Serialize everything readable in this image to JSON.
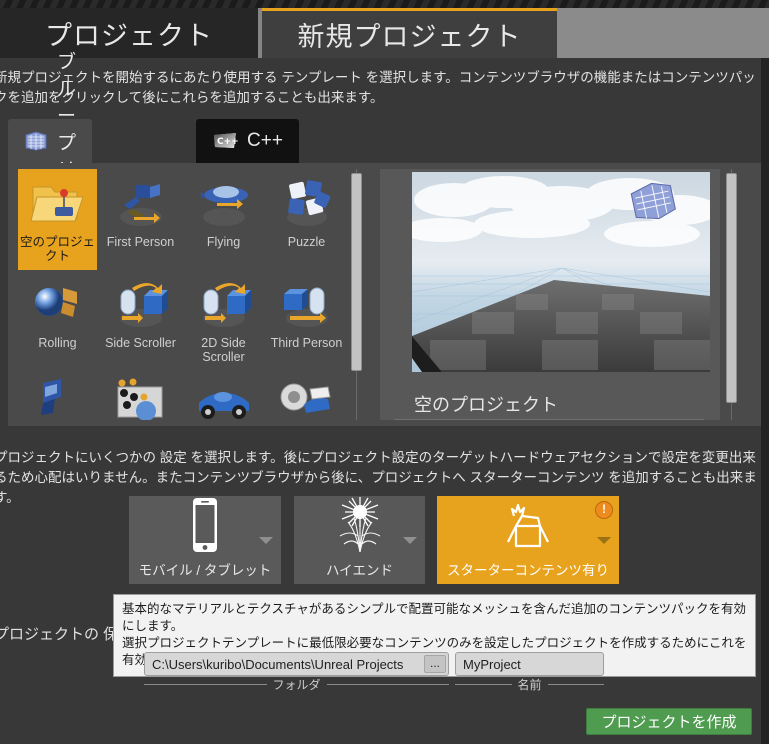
{
  "window": {
    "tabs": [
      {
        "label": "プロジェクト",
        "active": false
      },
      {
        "label": "新規プロジェクト",
        "active": true
      }
    ],
    "accent_color": "#e8a31e"
  },
  "template_section": {
    "description": "新規プロジェクトを開始するにあたり使用する テンプレート を選択します。コンテンツブラウザの機能またはコンテンツパックを追加をクリックして後にこれらを追加することも出来ます。",
    "category_tabs": [
      {
        "label": "ブループリント",
        "icon": "blueprint-icon",
        "active": true
      },
      {
        "label": "C++",
        "icon": "cpp-icon",
        "active": false
      }
    ],
    "templates": [
      {
        "label": "空のプロジェクト",
        "icon": "empty-project-icon",
        "selected": true
      },
      {
        "label": "First Person",
        "icon": "first-person-icon",
        "selected": false
      },
      {
        "label": "Flying",
        "icon": "flying-icon",
        "selected": false
      },
      {
        "label": "Puzzle",
        "icon": "puzzle-icon",
        "selected": false
      },
      {
        "label": "Rolling",
        "icon": "rolling-icon",
        "selected": false
      },
      {
        "label": "Side Scroller",
        "icon": "side-scroller-icon",
        "selected": false
      },
      {
        "label": "2D Side Scroller",
        "icon": "2d-side-scroller-icon",
        "selected": false
      },
      {
        "label": "Third Person",
        "icon": "third-person-icon",
        "selected": false
      },
      {
        "label": "",
        "icon": "twin-stick-icon",
        "selected": false
      },
      {
        "label": "",
        "icon": "top-down-icon",
        "selected": false
      },
      {
        "label": "",
        "icon": "vehicle-icon",
        "selected": false
      },
      {
        "label": "",
        "icon": "vehicle-advanced-icon",
        "selected": false
      }
    ],
    "preview": {
      "title": "空のプロジェクト",
      "image_alt": "空のプロジェクトのプレビュー"
    }
  },
  "settings_section": {
    "description": "プロジェクトにいくつかの 設定 を選択します。後にプロジェクト設定のターゲットハードウェアセクションで設定を変更出来るため心配はいりません。またコンテンツブラウザから後に、プロジェクトへ スターターコンテンツ を追加することも出来ます。",
    "options": [
      {
        "label": "モバイル / タブレット",
        "icon": "phone-icon",
        "selected": false,
        "has_warning": false
      },
      {
        "label": "ハイエンド",
        "icon": "scalability-grass-icon",
        "selected": false,
        "has_warning": false
      },
      {
        "label": "スターターコンテンツ有り",
        "icon": "content-box-icon",
        "selected": true,
        "has_warning": true,
        "warning_glyph": "!"
      }
    ],
    "tooltip": {
      "line1": "基本的なマテリアルとテクスチャがあるシンプルで配置可能なメッシュを含んだ追加のコンテンツパックを有効にします。",
      "line2": "選択プロジェクトテンプレートに最低限必要なコンテンツのみを設定したプロジェクトを作成するためにこれを有効にできます。"
    }
  },
  "save_section": {
    "label": "プロジェクトの 保存",
    "folder": {
      "value": "C:\\Users\\kuribo\\Documents\\Unreal Projects",
      "caption": "フォルダ",
      "browse_label": "..."
    },
    "name": {
      "value": "MyProject",
      "caption": "名前"
    }
  },
  "footer": {
    "create_button": "プロジェクトを作成",
    "create_button_color": "#4f9b4f"
  }
}
